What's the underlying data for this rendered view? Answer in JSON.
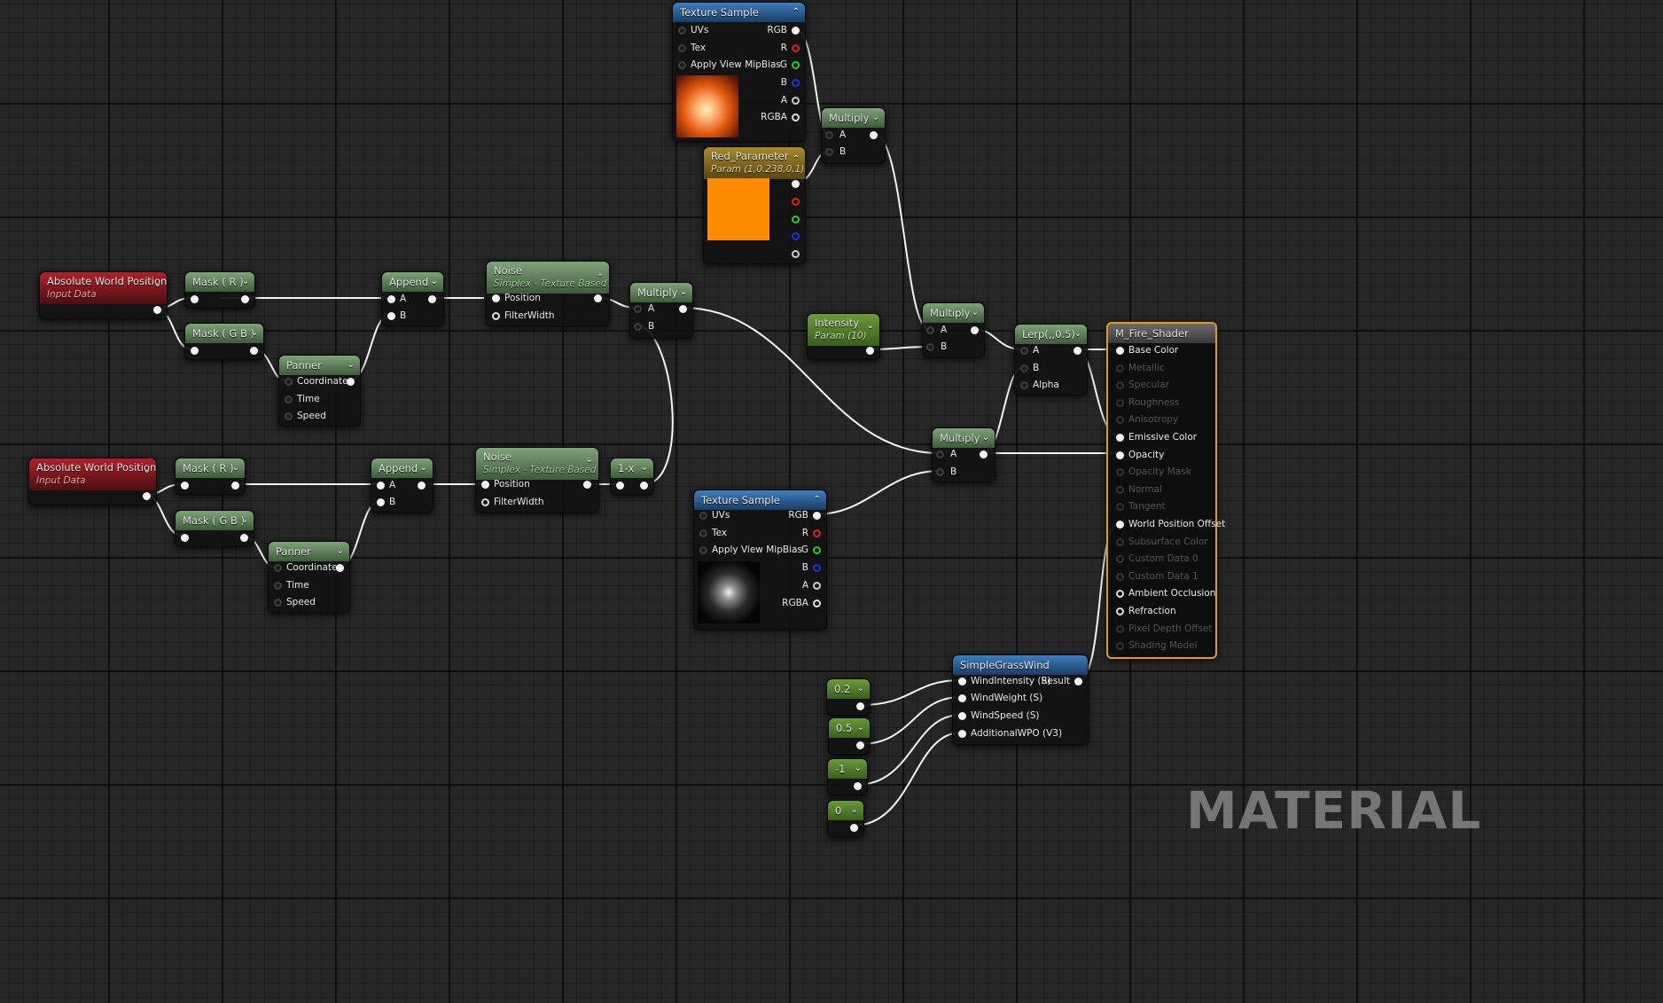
{
  "watermark": "MATERIAL",
  "colors": {
    "wire": "#f4f4f4",
    "final_border": "#e59a1f",
    "red_param": "#ff8c00"
  },
  "nodes": {
    "tex1": {
      "title": "Texture Sample",
      "in": [
        "UVs",
        "Tex",
        "Apply View MipBias"
      ],
      "out": [
        "RGB",
        "R",
        "G",
        "B",
        "A",
        "RGBA"
      ]
    },
    "red": {
      "title": "Red_Parameter",
      "sub": "Param (1,0.238,0,1)"
    },
    "mul_top": {
      "title": "Multiply",
      "in": [
        "A",
        "B"
      ]
    },
    "awp1": {
      "title": "Absolute World Position",
      "sub": "Input Data"
    },
    "maskr1": {
      "title": "Mask ( R )"
    },
    "maskgb1": {
      "title": "Mask ( G B )"
    },
    "append1": {
      "title": "Append",
      "in": [
        "A",
        "B"
      ]
    },
    "panner1": {
      "title": "Panner",
      "in": [
        "Coordinate",
        "Time",
        "Speed"
      ]
    },
    "noise1": {
      "title": "Noise",
      "sub": "Simplex - Texture Based",
      "in": [
        "Position",
        "FilterWidth"
      ]
    },
    "mul_mid": {
      "title": "Multiply",
      "in": [
        "A",
        "B"
      ]
    },
    "intensity": {
      "title": "Intensity",
      "sub": "Param (10)"
    },
    "mul_int": {
      "title": "Multiply",
      "in": [
        "A",
        "B"
      ]
    },
    "lerp": {
      "title": "Lerp(,,0.5)",
      "in": [
        "A",
        "B",
        "Alpha"
      ]
    },
    "awp2": {
      "title": "Absolute World Position",
      "sub": "Input Data"
    },
    "maskr2": {
      "title": "Mask ( R )"
    },
    "maskgb2": {
      "title": "Mask ( G B )"
    },
    "append2": {
      "title": "Append",
      "in": [
        "A",
        "B"
      ]
    },
    "panner2": {
      "title": "Panner",
      "in": [
        "Coordinate",
        "Time",
        "Speed"
      ]
    },
    "noise2": {
      "title": "Noise",
      "sub": "Simplex - Texture Based",
      "in": [
        "Position",
        "FilterWidth"
      ]
    },
    "oneminus": {
      "title": "1-x"
    },
    "mul_low": {
      "title": "Multiply",
      "in": [
        "A",
        "B"
      ]
    },
    "tex2": {
      "title": "Texture Sample",
      "in": [
        "UVs",
        "Tex",
        "Apply View MipBias"
      ],
      "out": [
        "RGB",
        "R",
        "G",
        "B",
        "A",
        "RGBA"
      ]
    },
    "grass": {
      "title": "SimpleGrassWind",
      "in": [
        "WindIntensity (S)",
        "WindWeight (S)",
        "WindSpeed (S)",
        "AdditionalWPO (V3)"
      ],
      "out": "Result"
    },
    "c02": {
      "title": "0.2"
    },
    "c05": {
      "title": "0.5"
    },
    "cm1": {
      "title": "-1"
    },
    "c0": {
      "title": "0"
    },
    "final": {
      "title": "M_Fire_Shader",
      "pins": [
        "Base Color",
        "Metallic",
        "Specular",
        "Roughness",
        "Anisotropy",
        "Emissive Color",
        "Opacity",
        "Opacity Mask",
        "Normal",
        "Tangent",
        "World Position Offset",
        "Subsurface Color",
        "Custom Data 0",
        "Custom Data 1",
        "Ambient Occlusion",
        "Refraction",
        "Pixel Depth Offset",
        "Shading Model"
      ]
    }
  }
}
